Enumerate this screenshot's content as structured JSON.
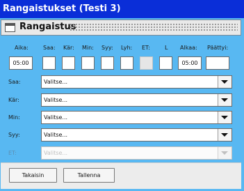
{
  "window": {
    "title": "Rangaistukset (Testi 3)"
  },
  "header": {
    "title": "Rangaistus"
  },
  "columns": [
    "Aika:",
    "Saa:",
    "Kär:",
    "Min:",
    "Syy:",
    "Lyh:",
    "ET:",
    "L",
    "Alkaa:",
    "Päättyi:"
  ],
  "fields": {
    "aika": "05:00",
    "alkaa": "05:00"
  },
  "rows": [
    {
      "label": "Saa:",
      "value": "Valitse..."
    },
    {
      "label": "Kär:",
      "value": "Valitse..."
    },
    {
      "label": "Min:",
      "value": "Valitse..."
    },
    {
      "label": "Syy:",
      "value": "Valitse..."
    },
    {
      "label": "ET:",
      "value": "Valitse..."
    }
  ],
  "buttons": {
    "back": "Takaisin",
    "save": "Tallenna"
  }
}
